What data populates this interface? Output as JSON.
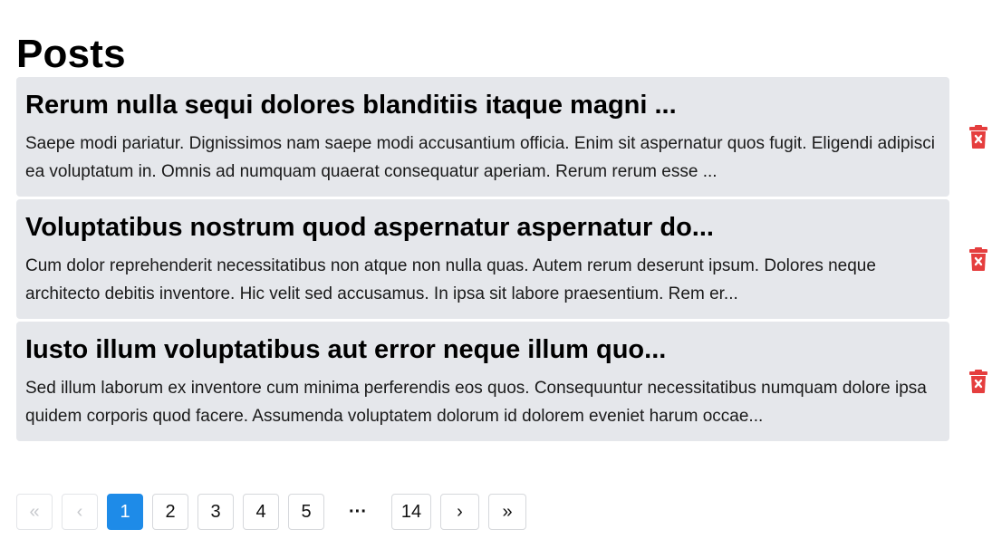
{
  "header": {
    "title": "Posts"
  },
  "posts": [
    {
      "title": "Rerum nulla sequi dolores blanditiis itaque magni ...",
      "body": "Saepe modi pariatur. Dignissimos nam saepe modi accusantium officia. Enim sit aspernatur quos fugit. Eligendi adipisci ea voluptatum in. Omnis ad numquam quaerat consequatur aperiam. Rerum rerum esse ..."
    },
    {
      "title": "Voluptatibus nostrum quod aspernatur aspernatur do...",
      "body": "Cum dolor reprehenderit necessitatibus non atque non nulla quas. Autem rerum deserunt ipsum. Dolores neque architecto debitis inventore. Hic velit sed accusamus. In ipsa sit labore praesentium. Rem er..."
    },
    {
      "title": "Iusto illum voluptatibus aut error neque illum quo...",
      "body": "Sed illum laborum ex inventore cum minima perferendis eos quos. Consequuntur necessitatibus numquam dolore ipsa quidem corporis quod facere. Assumenda voluptatem dolorum id dolorem eveniet harum occae..."
    }
  ],
  "delete_icon": {
    "name": "trash-icon",
    "color": "#e53e3e"
  },
  "pagination": {
    "first": "«",
    "prev": "‹",
    "pages": [
      "1",
      "2",
      "3",
      "4",
      "5"
    ],
    "current": "1",
    "ellipsis": "···",
    "last_page": "14",
    "next": "›",
    "last": "»",
    "active_color": "#1e8be8"
  }
}
